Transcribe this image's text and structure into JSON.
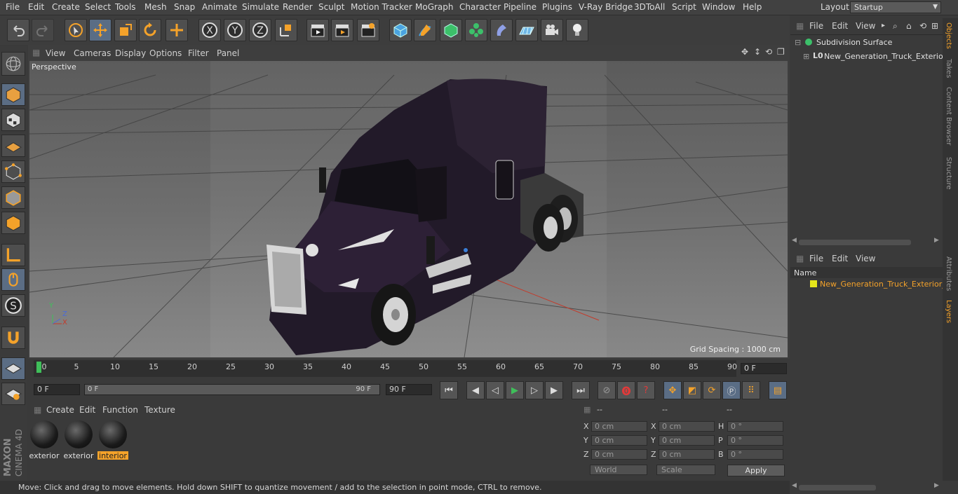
{
  "menu": [
    "File",
    "Edit",
    "Create",
    "Select",
    "Tools",
    "Mesh",
    "Snap",
    "Animate",
    "Simulate",
    "Render",
    "Sculpt",
    "Motion Tracker",
    "MoGraph",
    "Character",
    "Pipeline",
    "Plugins",
    "V-Ray Bridge",
    "3DToAll",
    "Script",
    "Window",
    "Help"
  ],
  "layout": {
    "label": "Layout:",
    "value": "Startup"
  },
  "viewport": {
    "menu": [
      "View",
      "Cameras",
      "Display",
      "Options",
      "Filter",
      "Panel"
    ],
    "label": "Perspective",
    "grid_spacing": "Grid Spacing : 1000 cm",
    "axes": {
      "x": "X",
      "y": "Y",
      "z": "Z"
    }
  },
  "timeline": {
    "ticks": [
      "0",
      "5",
      "10",
      "15",
      "20",
      "25",
      "30",
      "35",
      "40",
      "45",
      "50",
      "55",
      "60",
      "65",
      "70",
      "75",
      "80",
      "85",
      "90"
    ],
    "current_frame": "0 F",
    "start": "0 F",
    "range_start": "0 F",
    "range_end": "90 F",
    "end": "90 F"
  },
  "materials": {
    "menu": [
      "Create",
      "Edit",
      "Function",
      "Texture"
    ],
    "items": [
      {
        "name": "exterior",
        "active": false
      },
      {
        "name": "exterior",
        "active": false
      },
      {
        "name": "interior",
        "active": true
      }
    ]
  },
  "coords": {
    "headers": [
      "--",
      "--",
      "--"
    ],
    "rows": [
      {
        "a": "X",
        "av": "0 cm",
        "b": "X",
        "bv": "0 cm",
        "c": "H",
        "cv": "0 °"
      },
      {
        "a": "Y",
        "av": "0 cm",
        "b": "Y",
        "bv": "0 cm",
        "c": "P",
        "cv": "0 °"
      },
      {
        "a": "Z",
        "av": "0 cm",
        "b": "Z",
        "bv": "0 cm",
        "c": "B",
        "cv": "0 °"
      }
    ],
    "mode": "World",
    "scale": "Scale",
    "apply": "Apply"
  },
  "objects": {
    "menu": [
      "File",
      "Edit",
      "View"
    ],
    "items": [
      "Subdivision Surface",
      "New_Generation_Truck_Exterior_"
    ]
  },
  "layers": {
    "menu": [
      "File",
      "Edit",
      "View"
    ],
    "column": "Name",
    "items": [
      "New_Generation_Truck_Exterior_C"
    ]
  },
  "side_tabs": {
    "top": [
      "Objects",
      "Takes",
      "Content Browser",
      "Structure"
    ],
    "bottom": [
      "Attributes",
      "Layers"
    ]
  },
  "status": "Move: Click and drag to move elements. Hold down SHIFT to quantize movement / add to the selection in point mode, CTRL to remove.",
  "brand": {
    "line1": "MAXON",
    "line2": "CINEMA 4D"
  },
  "colors": {
    "accent": "#f4a22a",
    "selection": "#5a6d85",
    "viewport_bg": "#7a7a7a",
    "layer_color": "#e5e51a"
  }
}
